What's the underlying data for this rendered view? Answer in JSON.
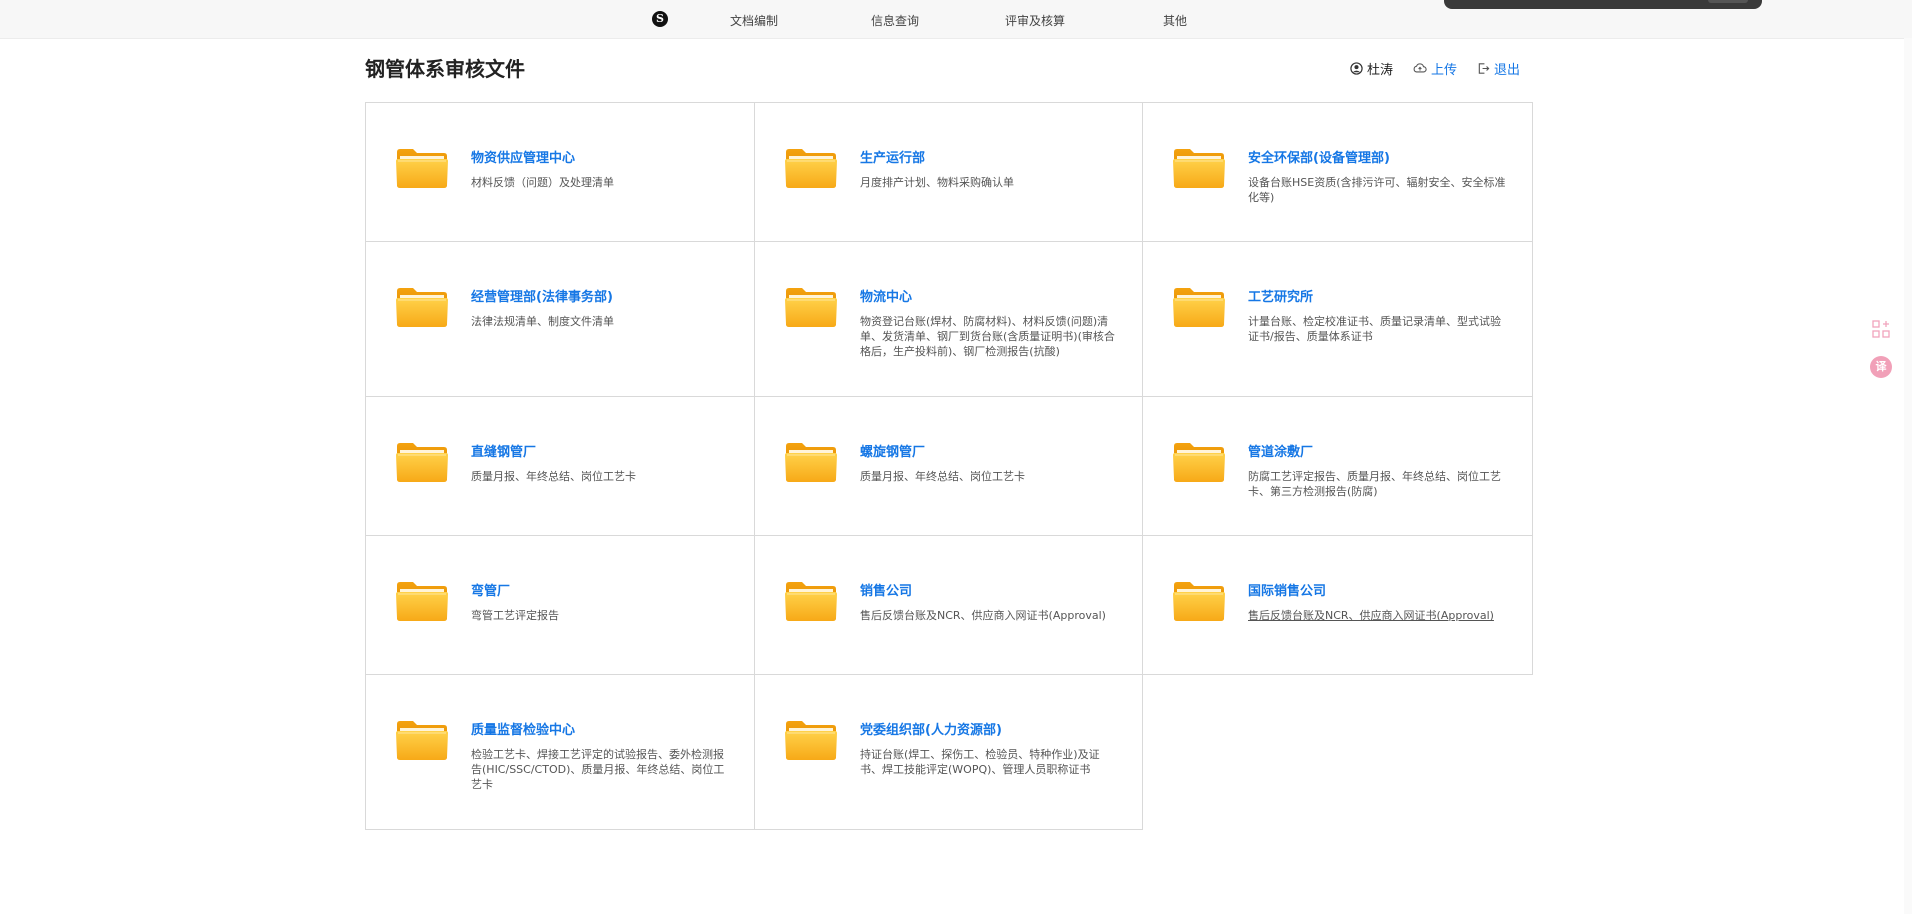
{
  "nav": {
    "logo_glyph": "S",
    "items": [
      "文档编制",
      "信息查询",
      "评审及核算",
      "其他"
    ]
  },
  "page": {
    "title": "钢管体系审核文件"
  },
  "user_area": {
    "user_name": "杜涛",
    "upload_label": "上传",
    "logout_label": "退出"
  },
  "colors": {
    "accent_link": "#1677e5",
    "folder_yellow": "#f9b21a",
    "translate_pink": "#f1a0b8"
  },
  "departments": [
    {
      "title": "物资供应管理中心",
      "desc": "材料反馈（问题）及处理清单",
      "icon": "folder-icon"
    },
    {
      "title": "生产运行部",
      "desc": "月度排产计划、物料采购确认单",
      "icon": "folder-icon"
    },
    {
      "title": "安全环保部(设备管理部)",
      "desc": "设备台账HSE资质(含排污许可、辐射安全、安全标准化等)",
      "icon": "folder-icon"
    },
    {
      "title": "经营管理部(法律事务部)",
      "desc": "法律法规清单、制度文件清单",
      "icon": "folder-icon"
    },
    {
      "title": "物流中心",
      "desc": "物资登记台账(焊材、防腐材料)、材料反馈(问题)清单、发货清单、钢厂到货台账(含质量证明书)(审核合格后，生产投料前)、钢厂检测报告(抗酸)",
      "icon": "folder-icon"
    },
    {
      "title": "工艺研究所",
      "desc": "计量台账、检定校准证书、质量记录清单、型式试验证书/报告、质量体系证书",
      "icon": "folder-icon"
    },
    {
      "title": "直缝钢管厂",
      "desc": "质量月报、年终总结、岗位工艺卡",
      "icon": "folder-icon"
    },
    {
      "title": "螺旋钢管厂",
      "desc": "质量月报、年终总结、岗位工艺卡",
      "icon": "folder-icon"
    },
    {
      "title": "管道涂敷厂",
      "desc": "防腐工艺评定报告、质量月报、年终总结、岗位工艺卡、第三方检测报告(防腐)",
      "icon": "folder-icon"
    },
    {
      "title": "弯管厂",
      "desc": "弯管工艺评定报告",
      "icon": "folder-icon"
    },
    {
      "title": "销售公司",
      "desc": "售后反馈台账及NCR、供应商入网证书(Approval)",
      "icon": "folder-icon"
    },
    {
      "title": "国际销售公司",
      "desc": "售后反馈台账及NCR、供应商入网证书(Approval)",
      "icon": "folder-icon",
      "desc_underlined": true
    },
    {
      "title": "质量监督检验中心",
      "desc": "检验工艺卡、焊接工艺评定的试验报告、委外检测报告(HIC/SSC/CTOD)、质量月报、年终总结、岗位工艺卡",
      "icon": "folder-icon"
    },
    {
      "title": "党委组织部(人力资源部)",
      "desc": "持证台账(焊工、探伤工、检验员、特种作业)及证书、焊工技能评定(WOPQ)、管理人员职称证书",
      "icon": "folder-icon"
    }
  ],
  "side_tools": {
    "grid_icon": "app-grid-plus-icon",
    "translate_icon": "translate-icon",
    "translate_glyph": "译"
  }
}
